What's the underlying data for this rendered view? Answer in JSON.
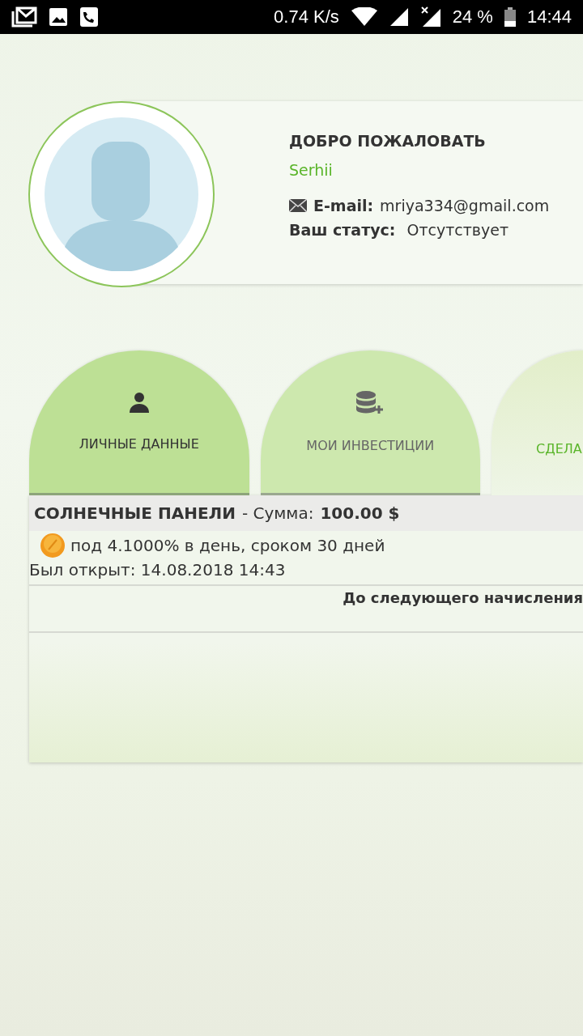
{
  "status_bar": {
    "speed": "0.74 K/s",
    "battery": "24 %",
    "time": "14:44"
  },
  "profile": {
    "greeting": "ДОБРО ПОЖАЛОВАТЬ",
    "name": "Serhii",
    "email_label": "E-mail:",
    "email": "mriya334@gmail.com",
    "status_label": "Ваш статус:",
    "status": "Отсутствует"
  },
  "tabs": [
    {
      "label": "ЛИЧНЫЕ ДАННЫЕ",
      "selected": true,
      "kind": "person"
    },
    {
      "label": "МОИ ИНВЕСТИЦИИ",
      "selected": false,
      "kind": "coins"
    },
    {
      "label": "СДЕЛА",
      "selected": false,
      "kind": "partial"
    }
  ],
  "investment": {
    "title": "СОЛНЕЧНЫЕ ПАНЕЛИ",
    "sum_label": "- Сумма:",
    "sum": "100.00 $",
    "terms": "под 4.1000% в день, сроком 30 дней",
    "opened": "Был открыт: 14.08.2018 14:43",
    "next_label": "До следующего начисления"
  }
}
